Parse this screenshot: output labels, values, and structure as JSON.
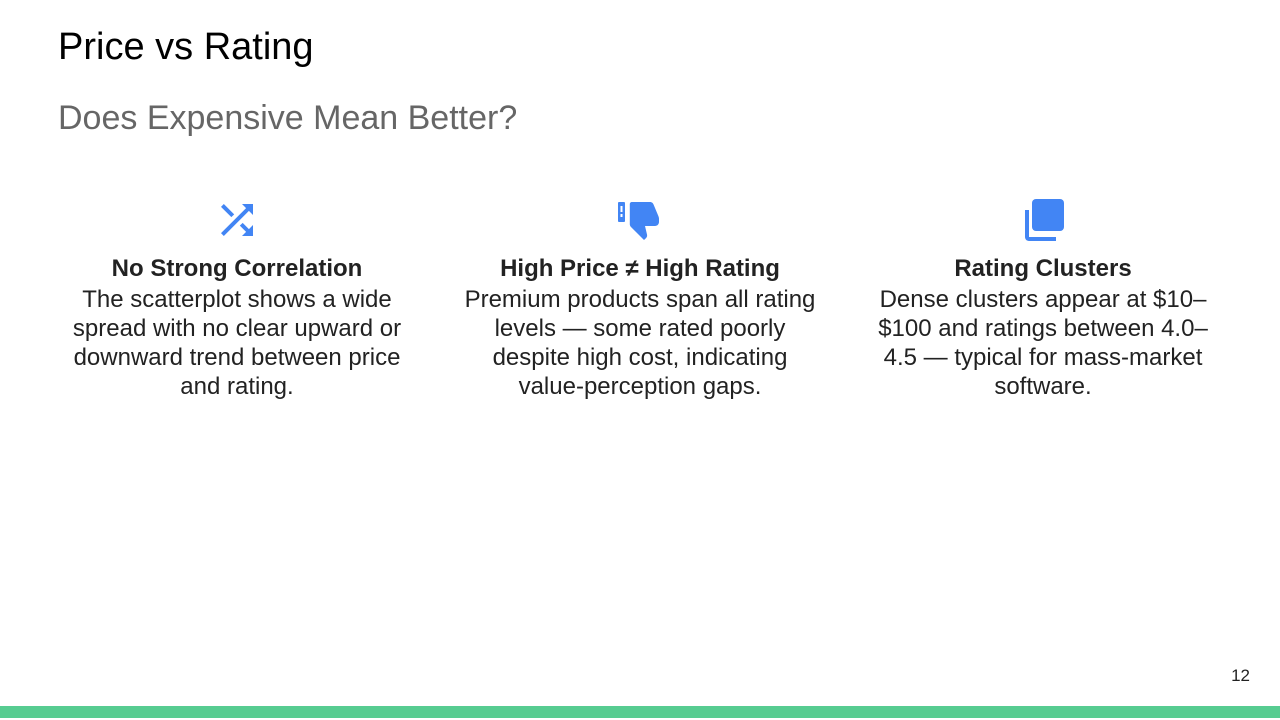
{
  "title": "Price vs Rating",
  "subtitle": "Does Expensive Mean Better?",
  "accent_color": "#4285f4",
  "bar_color": "#57cc91",
  "cards": [
    {
      "icon": "shuffle-icon",
      "heading": "No Strong Correlation",
      "text": "The scatterplot shows a wide spread with no clear upward or downward trend between price and rating."
    },
    {
      "icon": "thumbs-down-icon",
      "heading": "High Price ≠ High Rating",
      "text": "Premium products span all rating levels — some rated poorly despite high cost, indicating value-perception gaps."
    },
    {
      "icon": "stacked-layers-icon",
      "heading": "Rating Clusters",
      "text": "Dense clusters appear at $10–$100 and ratings between 4.0–4.5 — typical for mass-market software."
    }
  ],
  "page_number": "12"
}
